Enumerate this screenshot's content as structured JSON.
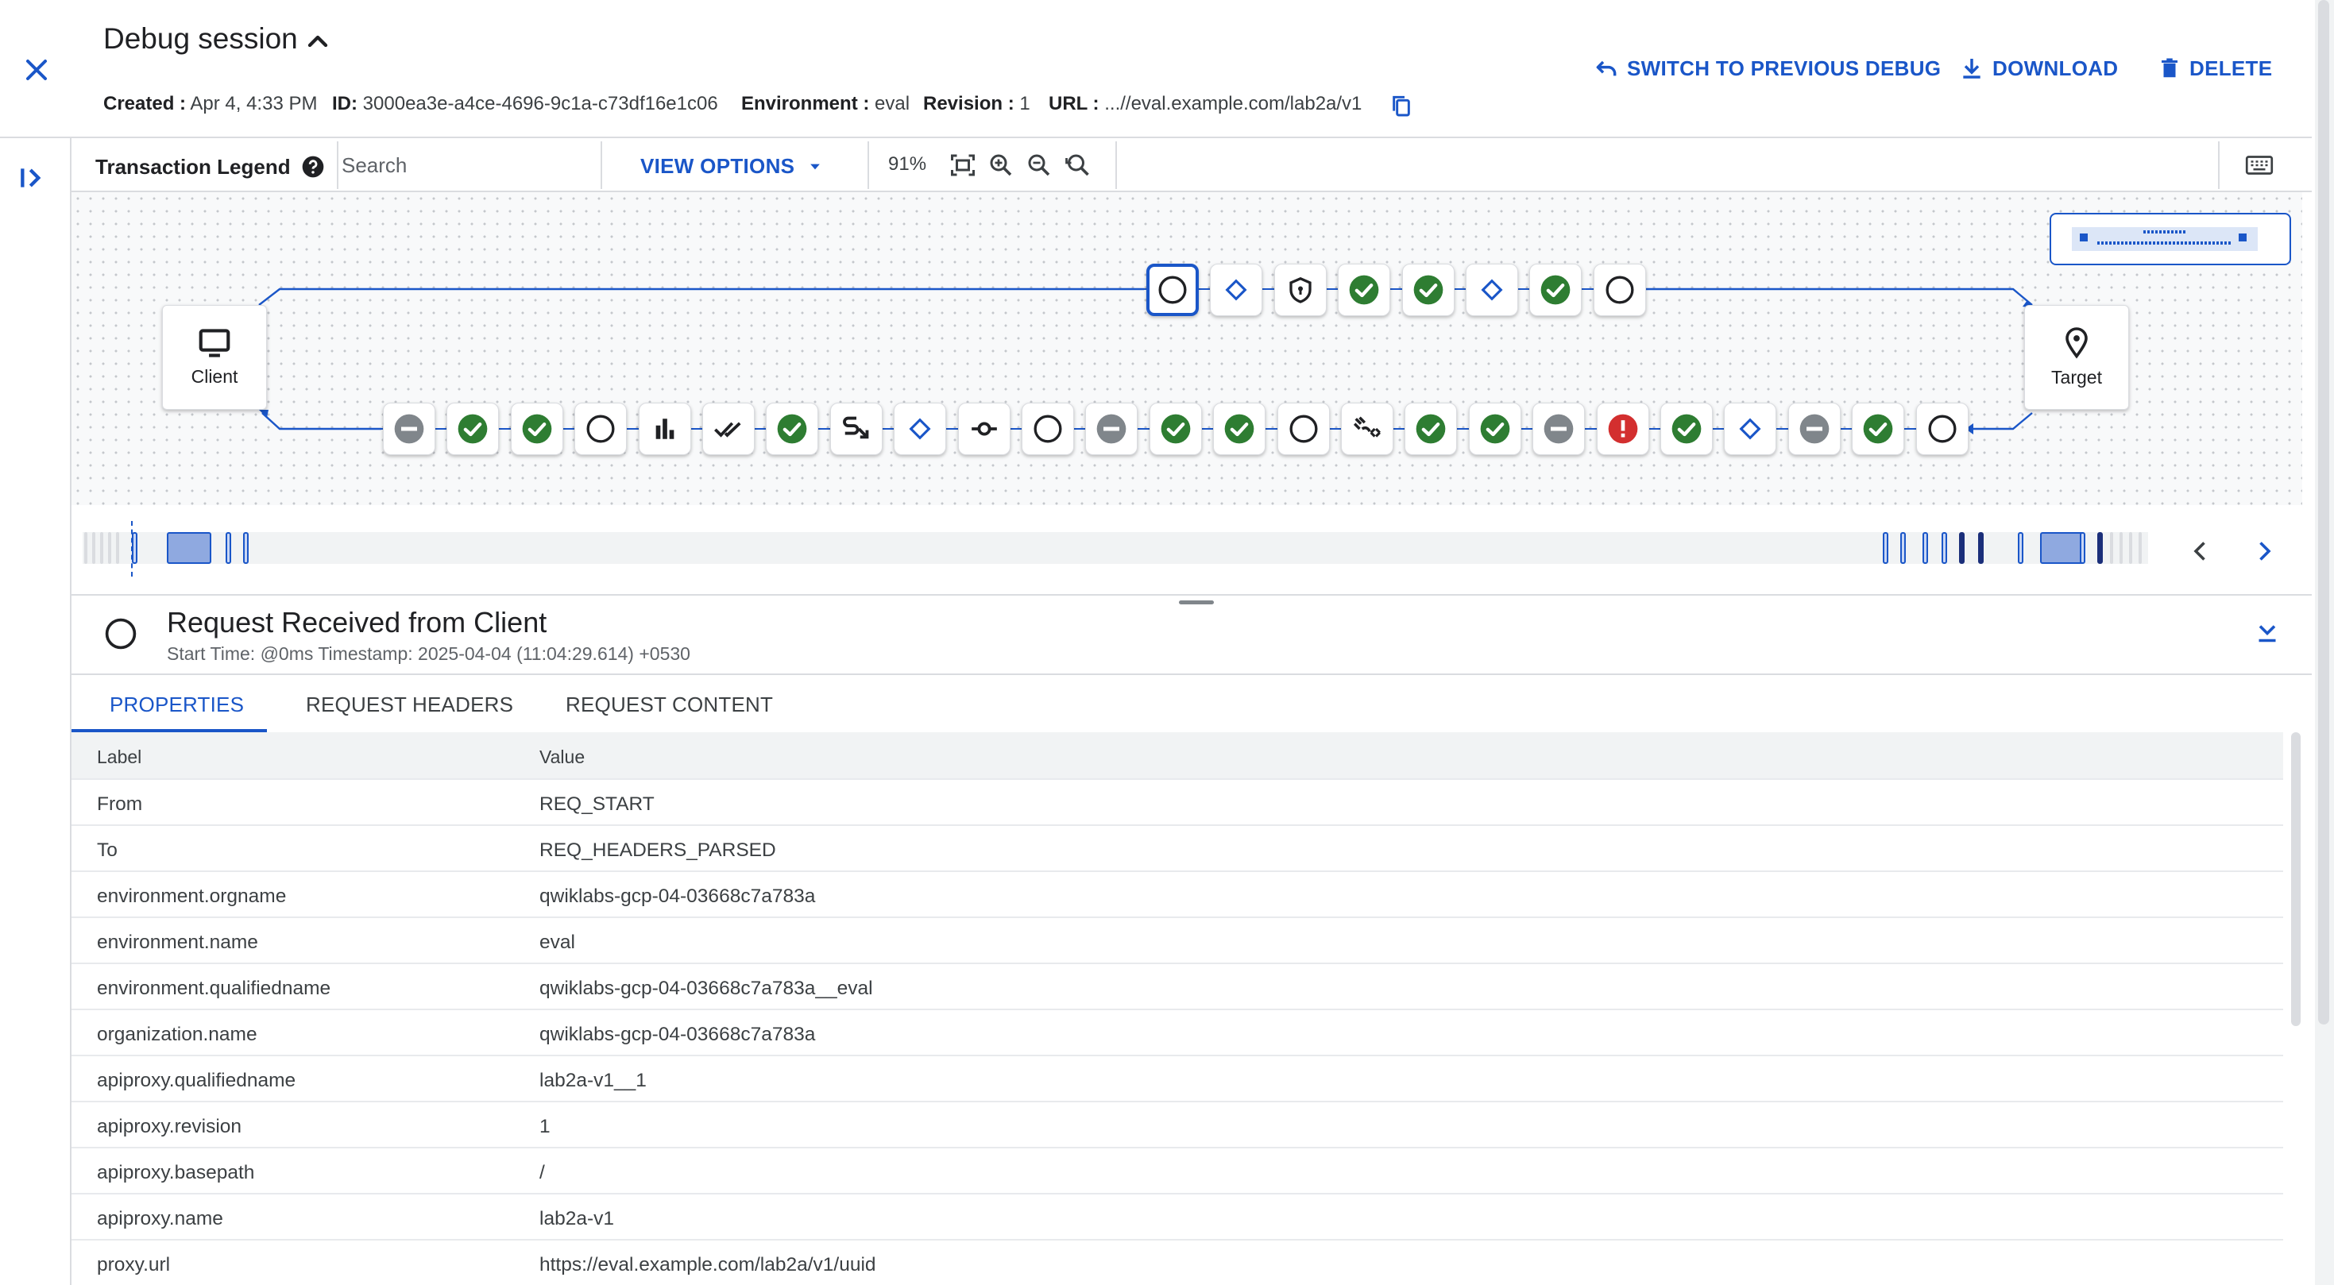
{
  "header": {
    "title": "Debug session",
    "created_label": "Created :",
    "created_value": "Apr 4, 4:33 PM",
    "id_label": "ID:",
    "id_value": "3000ea3e-a4ce-4696-9c1a-c73df16e1c06",
    "env_label": "Environment :",
    "env_value": "eval",
    "revision_label": "Revision :",
    "revision_value": "1",
    "url_label": "URL :",
    "url_value": "...//eval.example.com/lab2a/v1",
    "switch_label": "SWITCH TO PREVIOUS DEBUG",
    "download_label": "DOWNLOAD",
    "delete_label": "DELETE"
  },
  "toolbar": {
    "legend_label": "Transaction Legend",
    "search_placeholder": "Search",
    "view_options_label": "VIEW OPTIONS",
    "zoom_level": "91%"
  },
  "flow": {
    "client_label": "Client",
    "target_label": "Target",
    "request_nodes": [
      "circle",
      "diamond",
      "shield",
      "check",
      "check",
      "diamond",
      "check",
      "circle"
    ],
    "response_nodes": [
      "minus",
      "check",
      "check",
      "circle",
      "bars",
      "double-check",
      "check",
      "route",
      "diamond",
      "commit",
      "circle",
      "minus",
      "check",
      "check",
      "circle",
      "code-scan",
      "check",
      "check",
      "minus",
      "error",
      "check",
      "diamond",
      "minus",
      "check",
      "circle"
    ]
  },
  "details": {
    "title": "Request Received from Client",
    "subtitle": "Start Time: @0ms Timestamp: 2025-04-04 (11:04:29.614) +0530",
    "tabs": [
      "PROPERTIES",
      "REQUEST HEADERS",
      "REQUEST CONTENT"
    ],
    "active_tab": "PROPERTIES",
    "table_headers": [
      "Label",
      "Value"
    ],
    "rows": [
      [
        "From",
        "REQ_START"
      ],
      [
        "To",
        "REQ_HEADERS_PARSED"
      ],
      [
        "environment.orgname",
        "qwiklabs-gcp-04-03668c7a783a"
      ],
      [
        "environment.name",
        "eval"
      ],
      [
        "environment.qualifiedname",
        "qwiklabs-gcp-04-03668c7a783a__eval"
      ],
      [
        "organization.name",
        "qwiklabs-gcp-04-03668c7a783a"
      ],
      [
        "apiproxy.qualifiedname",
        "lab2a-v1__1"
      ],
      [
        "apiproxy.revision",
        "1"
      ],
      [
        "apiproxy.basepath",
        "/"
      ],
      [
        "apiproxy.name",
        "lab2a-v1"
      ],
      [
        "proxy.url",
        "https://eval.example.com/lab2a/v1/uuid"
      ]
    ]
  },
  "colors": {
    "accent": "#1a56c8",
    "success": "#2e7d32",
    "error": "#d32f2f",
    "neutral": "#80868b"
  }
}
